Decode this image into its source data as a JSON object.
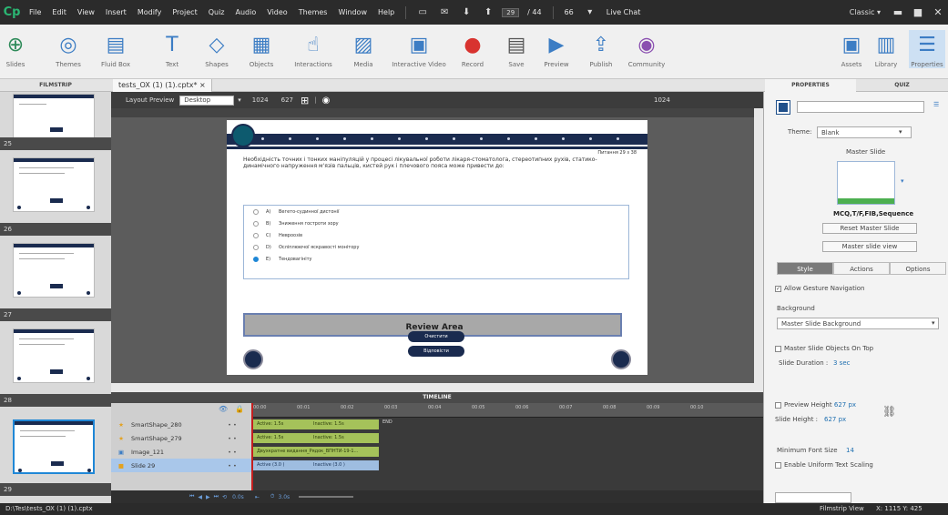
{
  "menubar": {
    "logo": "Cp",
    "items": [
      "File",
      "Edit",
      "View",
      "Insert",
      "Modify",
      "Project",
      "Quiz",
      "Audio",
      "Video",
      "Themes",
      "Window",
      "Help"
    ],
    "page_current": "29",
    "page_total": "/ 44",
    "zoom": "66",
    "live_chat": "Live Chat",
    "mode": "Classic"
  },
  "ribbon": {
    "left": [
      "Slides",
      "Themes",
      "Fluid Box",
      "Text",
      "Shapes",
      "Objects",
      "Interactions",
      "Media",
      "Interactive Video",
      "Record",
      "Save",
      "Preview",
      "Publish",
      "Community"
    ],
    "right": [
      "Assets",
      "Library",
      "Properties"
    ]
  },
  "panels": {
    "filmstrip": "FILMSTRIP",
    "doc_tab": "tests_OX (1) (1).cptx*",
    "doc_close": "×",
    "properties": "PROPERTIES",
    "quiz": "QUIZ"
  },
  "filmstrip": {
    "labels": [
      "25",
      "26",
      "27",
      "28",
      "29"
    ]
  },
  "layout": {
    "label": "Layout Preview",
    "device": "Desktop",
    "width": "1024",
    "height": "627",
    "ruler_right": "1024"
  },
  "slide": {
    "q_number": "Питання 29 з 38",
    "question": "Необхідність точних і тонких маніпуляцій у процесі лікувальної роботи лікаря-стоматолога, стереотипних рухів, статико-динамічного напруження м'язів пальців, кистей рук і плечового пояса може привести до:",
    "answers": [
      {
        "key": "A)",
        "text": "Вегето-судинної дистонії",
        "selected": false
      },
      {
        "key": "B)",
        "text": "Зниження гостроти зору",
        "selected": false
      },
      {
        "key": "C)",
        "text": "Невроозів",
        "selected": false
      },
      {
        "key": "D)",
        "text": "Осліплюючої яскравості монітору",
        "selected": false
      },
      {
        "key": "E)",
        "text": "Тендовагініту",
        "selected": true
      }
    ],
    "review": "Review Area",
    "btn_clear": "Очистити",
    "btn_submit": "Відповісти"
  },
  "timeline": {
    "title": "TIMELINE",
    "ticks": [
      "00:00",
      "00:01",
      "00:02",
      "00:03",
      "00:04",
      "00:05",
      "00:06",
      "00:07",
      "00:08",
      "00:09",
      "00:10"
    ],
    "rows": [
      {
        "name": "SmartShape_280",
        "bar": "Active: 1.5s",
        "bar2": "Inactive: 1.5s",
        "end": "END",
        "kind": "green",
        "selected": false
      },
      {
        "name": "SmartShape_279",
        "bar": "Active: 1.5s",
        "bar2": "Inactive: 1.5s",
        "end": "",
        "kind": "green",
        "selected": false
      },
      {
        "name": "Image_121",
        "bar": "Двухкратне видання_Рядок_ВПНТИ-19-1...",
        "bar2": "",
        "end": "",
        "kind": "image",
        "selected": false
      },
      {
        "name": "Slide 29",
        "bar": "Active (3.0 )",
        "bar2": "Inactive (3.0 )",
        "end": "",
        "kind": "blue",
        "selected": true
      }
    ],
    "ctrl_time1": "0.0s",
    "ctrl_time2": "3.0s"
  },
  "props": {
    "theme_label": "Theme:",
    "theme_value": "Blank",
    "master_label": "Master Slide",
    "master_name": "MCQ,T/F,FIB,Sequence",
    "reset": "Reset Master Slide",
    "master_view": "Master slide view",
    "tabs": [
      "Style",
      "Actions",
      "Options"
    ],
    "allow_gesture": "Allow Gesture Navigation",
    "background_label": "Background",
    "background_value": "Master Slide Background",
    "objects_on_top": "Master Slide Objects On Top",
    "duration_label": "Slide Duration :",
    "duration_value": "3 sec",
    "preview_height": "Preview Height",
    "preview_value": "627 px",
    "slide_height": "Slide Height :",
    "slide_height_value": "627 px",
    "min_font": "Minimum Font Size",
    "min_font_value": "14",
    "uniform": "Enable Uniform Text Scaling"
  },
  "status": {
    "path": "D:\\Tes\\tests_OX (1) (1).cptx",
    "view": "Filmstrip View",
    "coords": "X: 1115 Y: 425"
  }
}
